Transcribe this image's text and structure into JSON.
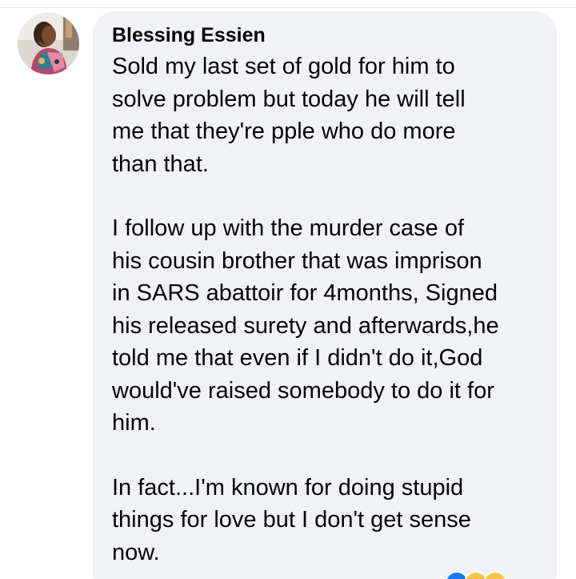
{
  "comment": {
    "author": "Blessing Essien",
    "paragraphs": [
      "Sold my last set of gold for him to\nsolve problem but today he will tell\nme that they're pple who do more\nthan that.",
      "I follow up with the murder case of\nhis cousin brother that was imprison\nin SARS abattoir for 4months, Signed\nhis released surety and afterwards,he\ntold me that even if I didn't do it,God\nwould've raised somebody to do it for\nhim.",
      "In fact...I'm known for doing stupid\nthings for love but I don't get sense\nnow."
    ],
    "reaction_icons": [
      "like-icon",
      "haha-icon",
      "wow-icon"
    ]
  },
  "colors": {
    "bubble_background": "#f0f2f5",
    "text": "#050505",
    "like_blue": "#1877f2",
    "emoji_yellow": "#f7c445"
  }
}
